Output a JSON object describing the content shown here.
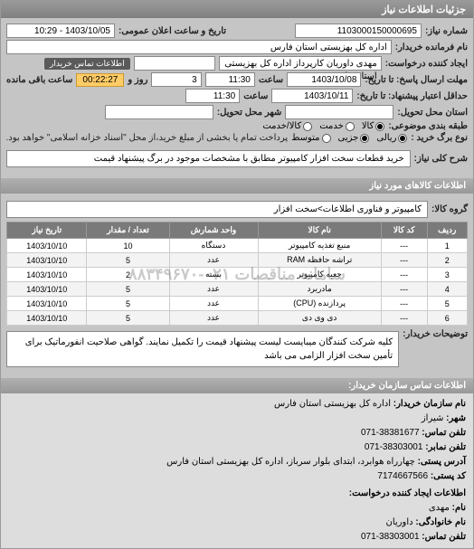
{
  "header": "جزئیات اطلاعات نیاز",
  "fields": {
    "request_no_label": "شماره نیاز:",
    "request_no": "1103000150000695",
    "announce_label": "تاریخ و ساعت اعلان عمومی:",
    "announce_value": "1403/10/05 - 10:29",
    "buyer_name_label": "نام فرمانده خریدار:",
    "buyer_name": "اداره کل بهزیستی استان فارس",
    "requester_label": "ایجاد کننده درخواست:",
    "requester": "مهدی داوریان کارپرداز اداره کل بهزیستی استان فارس",
    "contact_btn": "اطلاعات تماس خریدار",
    "deadline_label": "مهلت ارسال پاسخ: تا تاریخ:",
    "deadline_date": "1403/10/08",
    "time_label": "ساعت",
    "deadline_time": "11:30",
    "days_remaining": "3",
    "days_remaining_label": "روز و",
    "time_remaining": "00:22:27",
    "time_remaining_label": "ساعت باقی مانده",
    "validity_label": "حداقل اعتبار پیشنهاد: تا تاریخ:",
    "validity_date": "1403/10/11",
    "validity_time": "11:30",
    "delivery_province_label": "استان محل تحویل:",
    "delivery_city_label": "شهر محل تحویل:",
    "packaging_label": "طبقه بندی موضوعی:",
    "pkg_opt1": "کالا",
    "pkg_opt2": "خدمت",
    "pkg_opt3": "کالا/خدمت",
    "purchase_type_label": "نوع برگ خرید :",
    "pt_opt1": "ریالی",
    "pt_opt2": "جزیی",
    "pt_opt3": "متوسط",
    "purchase_note": "پرداخت تمام یا بخشی از مبلغ خرید،از محل \"اسناد خزانه اسلامی\" خواهد بود.",
    "description_label": "شرح کلی نیاز:",
    "description": "خرید قطعات سخت افزار کامپیوتر مطابق با مشخصات موجود در برگ پیشنهاد قیمت"
  },
  "goods_section_title": "اطلاعات کالاهای مورد نیاز",
  "goods_group_label": "گروه کالا:",
  "goods_group": "کامپیوتر و فناوری اطلاعات>سخت افزار",
  "table": {
    "headers": [
      "ردیف",
      "کد کالا",
      "نام کالا",
      "واحد شمارش",
      "تعداد / مقدار",
      "تاریخ نیاز"
    ],
    "rows": [
      [
        "1",
        "---",
        "منبع تغذیه کامپیوتر",
        "دستگاه",
        "10",
        "1403/10/10"
      ],
      [
        "2",
        "---",
        "تراشه حافظه RAM",
        "عدد",
        "5",
        "1403/10/10"
      ],
      [
        "3",
        "---",
        "جعبه کامپیوتر",
        "بسته",
        "2",
        "1403/10/10"
      ],
      [
        "4",
        "---",
        "مادربرد",
        "عدد",
        "5",
        "1403/10/10"
      ],
      [
        "5",
        "---",
        "پردازنده (CPU)",
        "عدد",
        "5",
        "1403/10/10"
      ],
      [
        "6",
        "---",
        "دی وی دی",
        "عدد",
        "5",
        "1403/10/10"
      ]
    ],
    "watermark": "سامانه مناقصات ۰۲۱-۸۸۳۴۹۶۷۰"
  },
  "buyer_notes_label": "توضیحات خریدار:",
  "buyer_notes": "کلیه شرکت کنندگان میبایست لیست پیشنهاد قیمت را تکمیل نمایند. گواهی صلاحیت انفورماتیک برای تأمین سخت افزار الزامی می باشد",
  "contact_title": "اطلاعات تماس سازمان خریدار:",
  "contact": {
    "org_label": "نام سازمان خریدار:",
    "org": "اداره کل بهزیستی استان فارس",
    "city_label": "شهر:",
    "city": "شیراز",
    "phone_label": "تلفن تماس:",
    "phone": "38381677-071",
    "fax_label": "تلفن نمابر:",
    "fax": "38303001-071",
    "address_label": "آدرس پستی:",
    "address": "چهارراه هوابرد، ابتدای بلوار سرباز، اداره کل بهزیستی استان فارس",
    "postal_label": "کد پستی:",
    "postal": "7174667566",
    "creator_title": "اطلاعات ایجاد کننده درخواست:",
    "name_label": "نام:",
    "name": "مهدی",
    "family_label": "نام خانوادگی:",
    "family": "داوریان",
    "cphone_label": "تلفن تماس:",
    "cphone": "38303001-071"
  }
}
